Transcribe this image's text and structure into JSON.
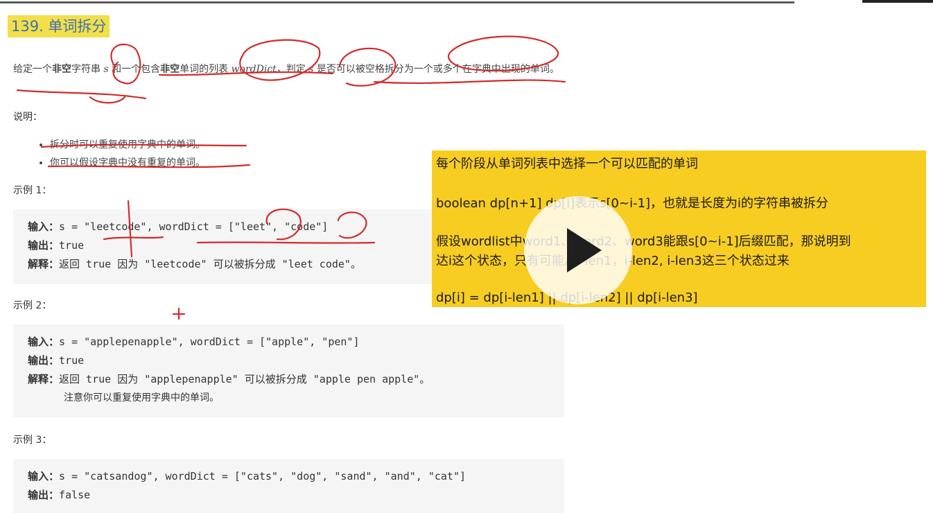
{
  "title": "139. 单词拆分",
  "description": {
    "part1": "给定一个",
    "strong1": "非空",
    "part2": "字符串 ",
    "var_s": "s",
    "part3": " 和一个包含",
    "strong2": "非空",
    "part4": "单词的列表 ",
    "var_dict": "wordDict",
    "part5": "，判定 ",
    "var_s2": "s",
    "part6": " 是否可以被空格拆分为一个或多个在字典中出现的单词。"
  },
  "notes_heading": "说明：",
  "notes": [
    "拆分时可以重复使用字典中的单词。",
    "你可以假设字典中没有重复的单词。"
  ],
  "examples": [
    {
      "heading": "示例 1：",
      "input_label": "输入：",
      "input": "s = \"leetcode\", wordDict = [\"leet\", \"code\"]",
      "output_label": "输出：",
      "output": "true",
      "explain_label": "解释：",
      "explain": "返回 true 因为 \"leetcode\" 可以被拆分成 \"leet code\"。"
    },
    {
      "heading": "示例 2：",
      "input_label": "输入：",
      "input": "s = \"applepenapple\", wordDict = [\"apple\", \"pen\"]",
      "output_label": "输出：",
      "output": "true",
      "explain_label": "解释：",
      "explain": "返回 true 因为 \"applepenapple\" 可以被拆分成 \"apple pen apple\"。",
      "explain2": "注意你可以重复使用字典中的单词。"
    },
    {
      "heading": "示例 3：",
      "input_label": "输入：",
      "input": "s = \"catsandog\", wordDict = [\"cats\", \"dog\", \"sand\", \"and\", \"cat\"]",
      "output_label": "输出：",
      "output": "false"
    }
  ],
  "overlay": {
    "line1": "每个阶段从单词列表中选择一个可以匹配的单词",
    "line2": "boolean dp[n+1]  dp[i]表示s[0~i-1]，也就是长度为i的字符串被拆分",
    "line3a": "假设wordlist中word1、word2、word3能跟s[0~i-1]后缀匹配，那说明到",
    "line3b": "达i这个状态，只有可能从i-len1，i-len2, i-len3这三个状态过来",
    "line4": "dp[i] = dp[i-len1] || dp[i-len2] || dp[i-len3]",
    "background": "#f8cd22"
  },
  "video": {
    "play_icon": "play-icon"
  },
  "colors": {
    "title_bg": "#f2df4a",
    "title_text": "#3c6fb3",
    "ink": "#d42a2a",
    "code_bg": "#f5f5f5"
  }
}
